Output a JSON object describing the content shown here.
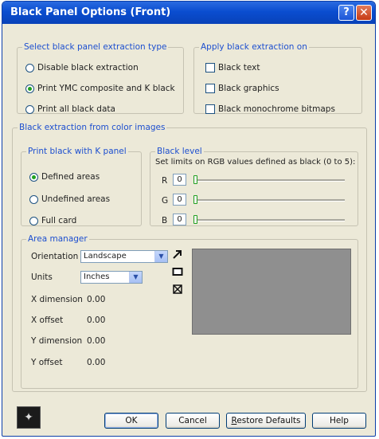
{
  "window": {
    "title": "Black Panel Options (Front)",
    "help_glyph": "?",
    "close_glyph": "✕"
  },
  "extraction_type": {
    "legend": "Select black panel extraction type",
    "options": [
      {
        "label": "Disable black extraction",
        "checked": false
      },
      {
        "label": "Print YMC composite and K black",
        "checked": true
      },
      {
        "label": "Print all black data",
        "checked": false
      }
    ]
  },
  "apply_on": {
    "legend": "Apply black extraction on",
    "options": [
      {
        "label": "Black text",
        "checked": false
      },
      {
        "label": "Black graphics",
        "checked": false
      },
      {
        "label": "Black monochrome bitmaps",
        "checked": false
      }
    ]
  },
  "color_images": {
    "legend": "Black extraction from color images",
    "print_k": {
      "legend": "Print black with K panel",
      "options": [
        {
          "label": "Defined areas",
          "checked": true
        },
        {
          "label": "Undefined areas",
          "checked": false
        },
        {
          "label": "Full card",
          "checked": false
        }
      ]
    },
    "black_level": {
      "legend": "Black level",
      "hint": "Set limits on RGB values defined as black (0 to 5):",
      "channels": [
        {
          "label": "R",
          "value": "0",
          "level": 0
        },
        {
          "label": "G",
          "value": "0",
          "level": 0
        },
        {
          "label": "B",
          "value": "0",
          "level": 0
        }
      ]
    }
  },
  "area_manager": {
    "legend": "Area manager",
    "orientation_label": "Orientation",
    "orientation_value": "Landscape",
    "units_label": "Units",
    "units_value": "Inches",
    "fields": [
      {
        "label": "X dimension",
        "value": "0.00"
      },
      {
        "label": "X offset",
        "value": "0.00"
      },
      {
        "label": "Y dimension",
        "value": "0.00"
      },
      {
        "label": "Y offset",
        "value": "0.00"
      }
    ],
    "preview_color": "#8f8f8f"
  },
  "footer": {
    "ok": "OK",
    "cancel": "Cancel",
    "restore_first": "R",
    "restore_rest": "estore Defaults",
    "help": "Help"
  },
  "colors": {
    "legend": "#1d4fcf",
    "titlebar": "#0a4dd0",
    "accent_check": "#21a121"
  },
  "icons": {
    "logo": "zebra-logo-icon",
    "arrow": "pointer-arrow-icon",
    "rect": "rectangle-tool-icon",
    "delete": "delete-area-icon"
  }
}
